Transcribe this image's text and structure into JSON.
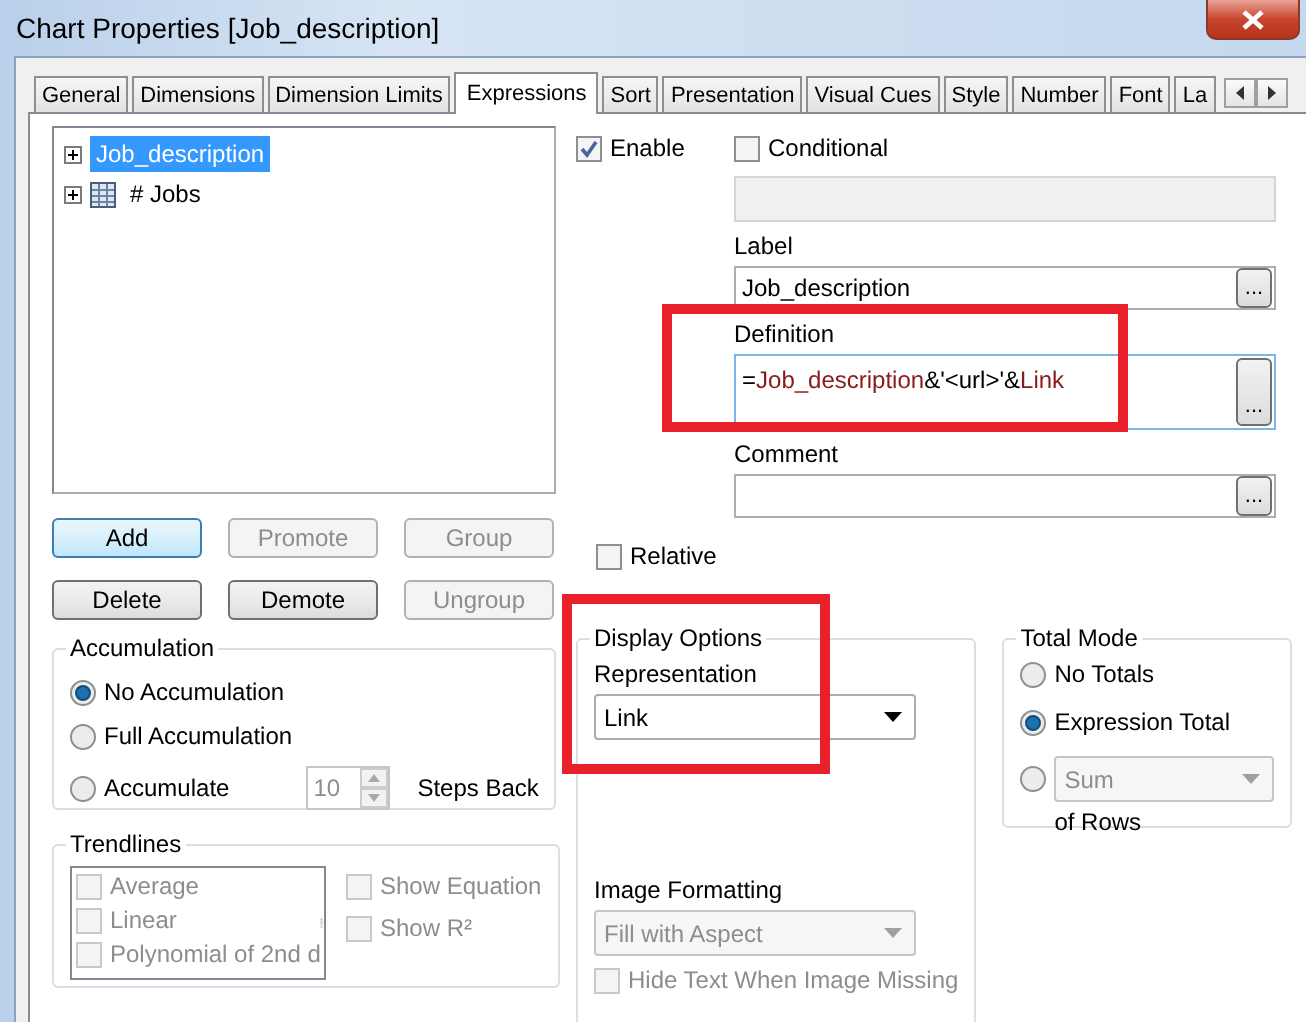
{
  "window": {
    "title": "Chart Properties [Job_description]"
  },
  "tabs": [
    {
      "label": "General",
      "selected": false
    },
    {
      "label": "Dimensions",
      "selected": false
    },
    {
      "label": "Dimension Limits",
      "selected": false
    },
    {
      "label": "Expressions",
      "selected": true
    },
    {
      "label": "Sort",
      "selected": false
    },
    {
      "label": "Presentation",
      "selected": false
    },
    {
      "label": "Visual Cues",
      "selected": false
    },
    {
      "label": "Style",
      "selected": false
    },
    {
      "label": "Number",
      "selected": false
    },
    {
      "label": "Font",
      "selected": false
    },
    {
      "label": "La",
      "selected": false
    }
  ],
  "expressions": [
    {
      "label": "Job_description",
      "kind": "plain",
      "selected": true
    },
    {
      "label": "# Jobs",
      "kind": "table",
      "selected": false
    }
  ],
  "list_buttons": [
    {
      "label": "Add",
      "disabled": false,
      "focused": true
    },
    {
      "label": "Promote",
      "disabled": true,
      "focused": false
    },
    {
      "label": "Group",
      "disabled": true,
      "focused": false
    },
    {
      "label": "Delete",
      "disabled": false,
      "focused": false
    },
    {
      "label": "Demote",
      "disabled": false,
      "focused": false
    },
    {
      "label": "Ungroup",
      "disabled": true,
      "focused": false
    }
  ],
  "accumulation": {
    "title": "Accumulation",
    "options": [
      {
        "label": "No Accumulation",
        "selected": true
      },
      {
        "label": "Full Accumulation",
        "selected": false
      },
      {
        "label": "Accumulate",
        "selected": false
      }
    ],
    "steps": {
      "value": "10",
      "disabled": true
    },
    "steps_label": "Steps Back"
  },
  "trendlines": {
    "title": "Trendlines",
    "items": [
      {
        "label": "Average",
        "checked": false,
        "disabled": true
      },
      {
        "label": "Linear",
        "checked": false,
        "disabled": true
      },
      {
        "label": "Polynomial of 2nd d",
        "checked": false,
        "disabled": true
      }
    ],
    "options": [
      {
        "label": "Show Equation",
        "checked": false,
        "disabled": true
      },
      {
        "label": "Show R²",
        "checked": false,
        "disabled": true
      }
    ]
  },
  "enable": {
    "label": "Enable",
    "checked": true
  },
  "conditional": {
    "label": "Conditional",
    "checked": false
  },
  "condition_field": {
    "disabled": true
  },
  "label_field": {
    "label": "Label",
    "value": "Job_description",
    "button": "..."
  },
  "definition": {
    "label": "Definition",
    "highlighted": true,
    "button": "...",
    "tokens": [
      {
        "text": "=",
        "kind": "operator"
      },
      {
        "text": "Job_description",
        "kind": "field"
      },
      {
        "text": "&'<url>'&",
        "kind": "operator"
      },
      {
        "text": "Link",
        "kind": "field"
      }
    ]
  },
  "comment": {
    "label": "Comment",
    "button": "..."
  },
  "relative": {
    "label": "Relative",
    "checked": false
  },
  "display_options": {
    "title": "Display Options",
    "highlighted": true,
    "representation": {
      "label": "Representation",
      "value": "Link",
      "disabled": false
    },
    "image_formatting": {
      "label": "Image Formatting",
      "value": "Fill with Aspect",
      "disabled": true
    },
    "hide_text": {
      "label": "Hide Text When Image Missing",
      "checked": false,
      "disabled": true
    }
  },
  "total_mode": {
    "title": "Total Mode",
    "options": [
      {
        "kind": "text",
        "label": "No Totals",
        "selected": false
      },
      {
        "kind": "text",
        "label": "Expression Total",
        "selected": true
      },
      {
        "kind": "aggregate",
        "value": "Sum",
        "disabled": true,
        "selected": false
      }
    ],
    "of_rows": "of Rows"
  }
}
